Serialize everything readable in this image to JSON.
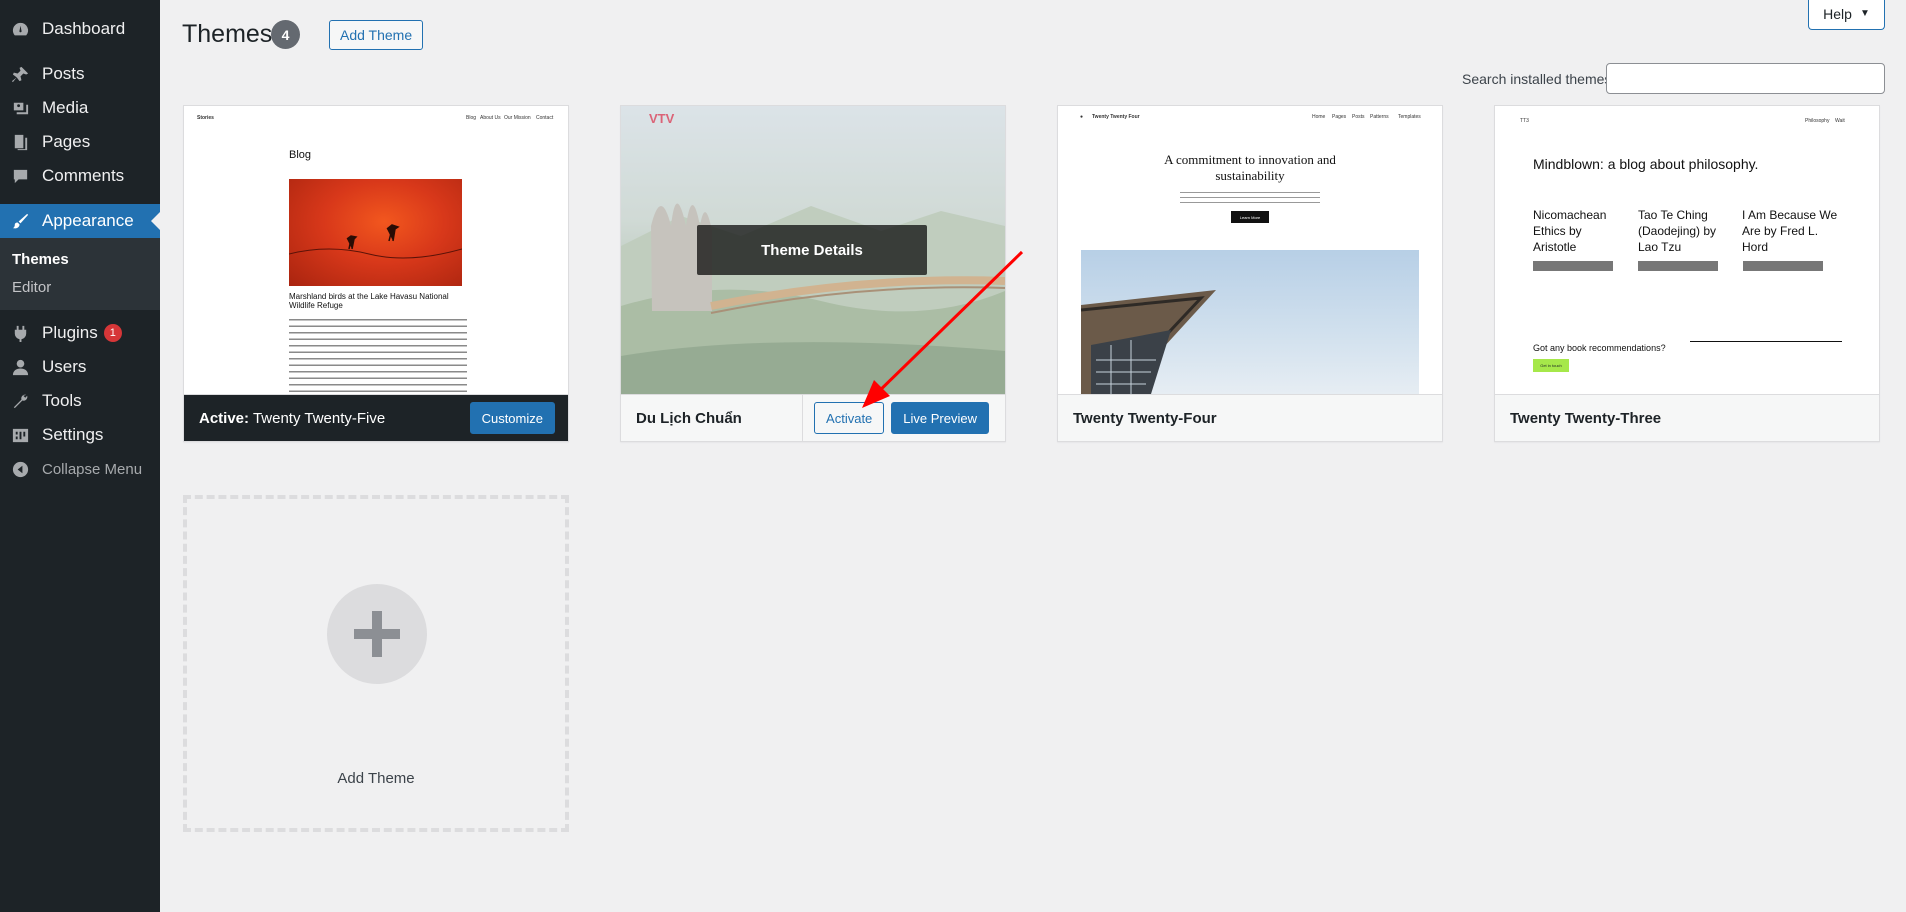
{
  "sidebar": {
    "items": [
      {
        "label": "Dashboard",
        "icon": "dashboard-icon"
      },
      {
        "label": "Posts",
        "icon": "pin-icon"
      },
      {
        "label": "Media",
        "icon": "media-icon"
      },
      {
        "label": "Pages",
        "icon": "pages-icon"
      },
      {
        "label": "Comments",
        "icon": "comment-icon"
      },
      {
        "label": "Appearance",
        "icon": "brush-icon"
      },
      {
        "label": "Plugins",
        "icon": "plugin-icon",
        "badge": "1"
      },
      {
        "label": "Users",
        "icon": "user-icon"
      },
      {
        "label": "Tools",
        "icon": "wrench-icon"
      },
      {
        "label": "Settings",
        "icon": "settings-icon"
      }
    ],
    "submenu": [
      "Themes",
      "Editor"
    ],
    "collapse_label": "Collapse Menu"
  },
  "header": {
    "title": "Themes",
    "count": "4",
    "add_theme_label": "Add Theme",
    "help_label": "Help",
    "search_label": "Search installed themes",
    "search_value": ""
  },
  "themes": [
    {
      "name": "Twenty Twenty-Five",
      "active_prefix": "Active:",
      "customize_label": "Customize",
      "preview": {
        "site_title": "Stories",
        "nav": [
          "Blog",
          "About Us",
          "Our Mission",
          "Contact"
        ],
        "heading": "Blog",
        "caption": "Marshland birds at the Lake Havasu National Wildlife Refuge"
      }
    },
    {
      "name": "Du Lịch Chuẩn",
      "details_label": "Theme Details",
      "activate_label": "Activate",
      "live_preview_label": "Live Preview",
      "preview": {
        "logo": "VTV"
      }
    },
    {
      "name": "Twenty Twenty-Four",
      "preview": {
        "site_title": "Twenty Twenty Four",
        "nav": [
          "Home",
          "Pages",
          "Posts",
          "Patterns",
          "Templates"
        ],
        "headline": "A commitment to innovation and sustainability",
        "button": "Learn More"
      }
    },
    {
      "name": "Twenty Twenty-Three",
      "preview": {
        "site_title": "TT3",
        "nav": [
          "Philosophy",
          "Wait"
        ],
        "headline": "Mindblown: a blog about philosophy.",
        "posts": [
          "Nicomachean Ethics by Aristotle",
          "Tao Te Ching (Daodejing) by Lao Tzu",
          "I Am Because We Are by Fred L. Hord"
        ],
        "cta": "Got any book recommendations?",
        "cta_button": "Get in touch"
      }
    }
  ],
  "add_new_theme_label": "Add Theme",
  "colors": {
    "sidebar_bg": "#1d2327",
    "accent": "#2271b1",
    "badge": "#d63638",
    "annotation_arrow": "#ff0000"
  }
}
